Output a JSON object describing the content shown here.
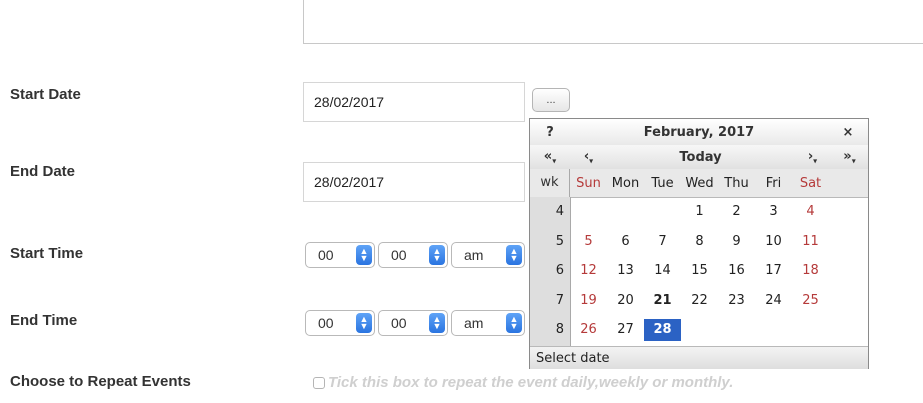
{
  "form": {
    "start_date_label": "Start Date",
    "end_date_label": "End Date",
    "start_time_label": "Start Time",
    "end_time_label": "End Time",
    "repeat_label": "Choose to Repeat Events",
    "start_date_value": "28/02/2017",
    "end_date_value": "28/02/2017",
    "calendar_button_label": "...",
    "start_time": {
      "hour": "00",
      "minute": "00",
      "ampm": "am"
    },
    "end_time": {
      "hour": "00",
      "minute": "00",
      "ampm": "am"
    },
    "repeat_hint": "Tick this box to repeat the event daily,weekly or monthly."
  },
  "calendar": {
    "help": "?",
    "title": "February, 2017",
    "close": "×",
    "nav": {
      "prev_year": "«",
      "prev_month": "‹",
      "today": "Today",
      "next_month": "›",
      "next_year": "»"
    },
    "weekday_header": [
      "wk",
      "Sun",
      "Mon",
      "Tue",
      "Wed",
      "Thu",
      "Fri",
      "Sat"
    ],
    "weeks": [
      {
        "wk": "4",
        "days": [
          "",
          "",
          "",
          "1",
          "2",
          "3",
          "4"
        ]
      },
      {
        "wk": "5",
        "days": [
          "5",
          "6",
          "7",
          "8",
          "9",
          "10",
          "11"
        ]
      },
      {
        "wk": "6",
        "days": [
          "12",
          "13",
          "14",
          "15",
          "16",
          "17",
          "18"
        ]
      },
      {
        "wk": "7",
        "days": [
          "19",
          "20",
          "21",
          "22",
          "23",
          "24",
          "25"
        ]
      },
      {
        "wk": "8",
        "days": [
          "26",
          "27",
          "28",
          "",
          "",
          "",
          ""
        ]
      }
    ],
    "today_day": "21",
    "selected_day": "28",
    "status": "Select date",
    "weekend_color": "#b53a3a",
    "selected_color": "#2b62c4"
  }
}
